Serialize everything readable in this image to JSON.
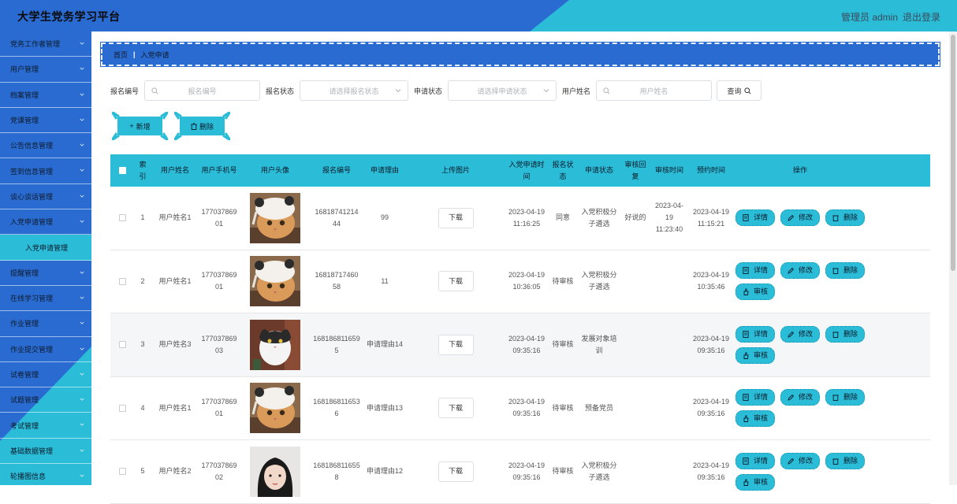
{
  "header": {
    "title": "大学生党务学习平台",
    "user": "管理员 admin",
    "logout": "退出登录"
  },
  "sidebar": {
    "items": [
      {
        "label": "党务工作者管理"
      },
      {
        "label": "用户管理"
      },
      {
        "label": "档案管理"
      },
      {
        "label": "党课管理"
      },
      {
        "label": "公告信息管理"
      },
      {
        "label": "签到信息管理"
      },
      {
        "label": "谈心谈话管理"
      },
      {
        "label": "入党申请管理"
      },
      {
        "label": "入党申请管理",
        "sub": true
      },
      {
        "label": "提醒管理"
      },
      {
        "label": "在线学习管理"
      },
      {
        "label": "作业管理"
      },
      {
        "label": "作业提交管理"
      },
      {
        "label": "试卷管理"
      },
      {
        "label": "试题管理"
      },
      {
        "label": "考试管理"
      },
      {
        "label": "基础数据管理"
      },
      {
        "label": "轮播图信息"
      }
    ]
  },
  "breadcrumb": {
    "home": "首页",
    "current": "入党申请"
  },
  "search": {
    "label_no": "报名编号",
    "placeholder_no": "报名编号",
    "label_status": "报名状态",
    "placeholder_status": "请选择报名状态",
    "label_apply_status": "申请状态",
    "placeholder_apply_status": "请选择申请状态",
    "label_name": "用户姓名",
    "placeholder_name": "用户姓名",
    "button": "查询"
  },
  "actions": {
    "add": "新增",
    "delete": "删除"
  },
  "table": {
    "headers": [
      "索引",
      "用户姓名",
      "用户手机号",
      "用户头像",
      "报名编号",
      "申请理由",
      "上传图片",
      "入党申请时间",
      "报名状态",
      "申请状态",
      "审核回复",
      "审核时间",
      "预约时间",
      "操作"
    ],
    "download": "下载",
    "op_detail": "详情",
    "op_edit": "修改",
    "op_delete": "删除",
    "op_review": "审核",
    "rows": [
      {
        "index": "1",
        "name": "用户姓名1",
        "phone": "17703786901",
        "avatar": "cat-hat",
        "no": "1681874121444",
        "reason": "99",
        "apply_time": "2023-04-19 11:16:25",
        "reg_status": "同意",
        "apply_status": "入党积极分子遴选",
        "reply": "好说的",
        "review_time": "2023-04-19 11:23:40",
        "appoint_time": "2023-04-19 11:15:21",
        "can_review": false
      },
      {
        "index": "2",
        "name": "用户姓名1",
        "phone": "17703786901",
        "avatar": "cat-hat",
        "no": "1681871746058",
        "reason": "11",
        "apply_time": "2023-04-19 10:36:05",
        "reg_status": "待审核",
        "apply_status": "入党积极分子遴选",
        "reply": "",
        "review_time": "",
        "appoint_time": "2023-04-19 10:35:46",
        "can_review": true
      },
      {
        "index": "3",
        "name": "用户姓名3",
        "phone": "17703786903",
        "avatar": "cat-bw",
        "no": "1681868116595",
        "reason": "申请理由14",
        "apply_time": "2023-04-19 09:35:16",
        "reg_status": "待审核",
        "apply_status": "发展对象培训",
        "reply": "",
        "review_time": "",
        "appoint_time": "2023-04-19 09:35:16",
        "can_review": true
      },
      {
        "index": "4",
        "name": "用户姓名1",
        "phone": "17703786901",
        "avatar": "cat-hat",
        "no": "1681868116536",
        "reason": "申请理由13",
        "apply_time": "2023-04-19 09:35:16",
        "reg_status": "待审核",
        "apply_status": "预备党员",
        "reply": "",
        "review_time": "",
        "appoint_time": "2023-04-19 09:35:16",
        "can_review": true
      },
      {
        "index": "5",
        "name": "用户姓名2",
        "phone": "17703786902",
        "avatar": "girl",
        "no": "1681868116558",
        "reason": "申请理由12",
        "apply_time": "2023-04-19 09:35:16",
        "reg_status": "待审核",
        "apply_status": "入党积极分子遴选",
        "reply": "",
        "review_time": "",
        "appoint_time": "2023-04-19 09:35:16",
        "can_review": true
      }
    ]
  },
  "colors": {
    "primary_blue": "#2a6bd1",
    "accent_cyan": "#2bbcd8"
  }
}
